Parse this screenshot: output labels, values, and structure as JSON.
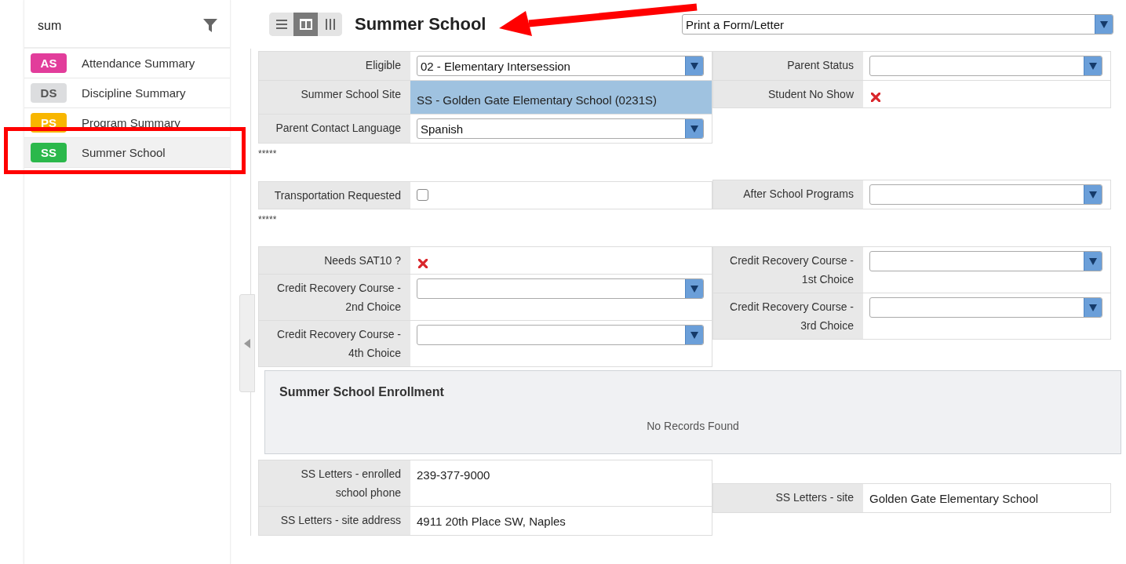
{
  "sidebar": {
    "search": {
      "value": "sum"
    },
    "items": [
      {
        "badge": "AS",
        "label": "Attendance Summary",
        "color": "#e23d9b",
        "selected": false
      },
      {
        "badge": "DS",
        "label": "Discipline Summary",
        "color": "#dcdddf",
        "selected": false
      },
      {
        "badge": "PS",
        "label": "Program Summary",
        "color": "#f8b600",
        "selected": false
      },
      {
        "badge": "SS",
        "label": "Summer School",
        "color": "#2bb84b",
        "selected": true
      }
    ]
  },
  "header": {
    "views": [
      {
        "kind": "list",
        "selected": false
      },
      {
        "kind": "split",
        "selected": true
      },
      {
        "kind": "columns",
        "selected": false
      }
    ],
    "title": "Summer School",
    "print_menu": {
      "value": "Print a Form/Letter"
    }
  },
  "blocks": [
    {
      "kind": "fields",
      "left": [
        {
          "label": "Eligible",
          "kind": "select",
          "value": "02 - Elementary Intersession"
        },
        {
          "label": "Summer School Site",
          "kind": "highlight",
          "value": "SS - Golden Gate Elementary School (0231S)"
        },
        {
          "label": "Parent Contact Language",
          "kind": "select",
          "value": "Spanish"
        }
      ],
      "right": [
        {
          "label": "Parent Status",
          "kind": "select"
        },
        {
          "label": "Student No Show",
          "kind": "cross"
        }
      ]
    },
    {
      "kind": "separator",
      "text": "*****"
    },
    {
      "kind": "fields",
      "left": [
        {
          "label": "Transportation Requested",
          "kind": "checkbox",
          "checked": false
        }
      ],
      "right": [
        {
          "label": "After School Programs",
          "kind": "select"
        }
      ]
    },
    {
      "kind": "separator",
      "text": "*****"
    },
    {
      "kind": "fields",
      "left": [
        {
          "label": "Needs SAT10 ?",
          "kind": "cross"
        },
        {
          "label": "Credit Recovery Course - 2nd Choice",
          "kind": "select"
        },
        {
          "label": "Credit Recovery Course - 4th Choice",
          "kind": "select"
        }
      ],
      "right": [
        {
          "label": "Credit Recovery Course - 1st Choice",
          "kind": "select"
        },
        {
          "label": "Credit Recovery Course - 3rd Choice",
          "kind": "select"
        }
      ]
    },
    {
      "kind": "panel",
      "title": "Summer School Enrollment",
      "message": "No Records Found"
    },
    {
      "kind": "fields",
      "left": [
        {
          "label": "SS Letters - enrolled school phone",
          "kind": "text",
          "value": "239-377-9000"
        },
        {
          "label": "SS Letters - site address",
          "kind": "text",
          "value": "4911 20th Place SW, Naples"
        }
      ],
      "right": [
        {
          "label": "SS Letters - site",
          "kind": "text",
          "value": "Golden Gate Elementary School"
        }
      ]
    }
  ]
}
